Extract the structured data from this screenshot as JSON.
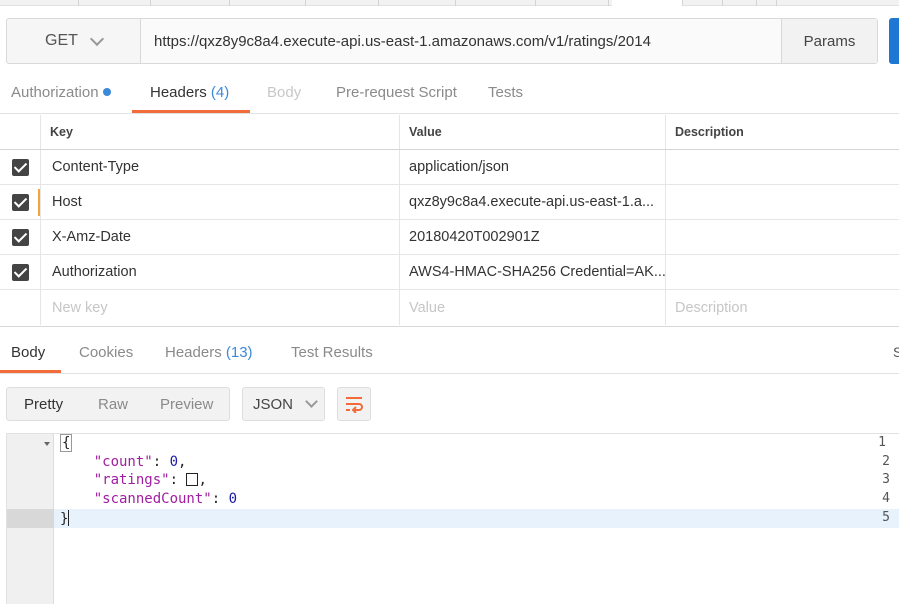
{
  "request": {
    "method": "GET",
    "url": "https://qxz8y9c8a4.execute-api.us-east-1.amazonaws.com/v1/ratings/2014",
    "params_label": "Params"
  },
  "request_tabs": {
    "authorization": "Authorization",
    "headers": "Headers",
    "headers_count": "(4)",
    "body": "Body",
    "prerequest": "Pre-request Script",
    "tests": "Tests"
  },
  "headers_table": {
    "columns": {
      "key": "Key",
      "value": "Value",
      "description": "Description"
    },
    "rows": [
      {
        "key": "Content-Type",
        "value": "application/json",
        "description": ""
      },
      {
        "key": "Host",
        "value": "qxz8y9c8a4.execute-api.us-east-1.a...",
        "description": ""
      },
      {
        "key": "X-Amz-Date",
        "value": "20180420T002901Z",
        "description": ""
      },
      {
        "key": "Authorization",
        "value": "AWS4-HMAC-SHA256 Credential=AK...",
        "description": ""
      }
    ],
    "placeholders": {
      "key": "New key",
      "value": "Value",
      "description": "Description"
    }
  },
  "response_tabs": {
    "body": "Body",
    "cookies": "Cookies",
    "headers": "Headers",
    "headers_count": "(13)",
    "test_results": "Test Results",
    "cut_label": "S"
  },
  "response_toolbar": {
    "pretty": "Pretty",
    "raw": "Raw",
    "preview": "Preview",
    "format": "JSON",
    "wrap_icon": "wrap-lines-icon"
  },
  "code": {
    "line_numbers": [
      "1",
      "2",
      "3",
      "4",
      "5"
    ],
    "open_brace": "{",
    "close_brace": "}",
    "key_count": "\"count\"",
    "val_count": "0",
    "key_ratings": "\"ratings\"",
    "key_scanned": "\"scannedCount\"",
    "val_scanned": "0"
  },
  "colors": {
    "accent": "#f26b3a",
    "link_blue": "#3b8ad9",
    "send_blue": "#1e77d3",
    "json_key": "#a11da1",
    "json_number": "#1a1aa6"
  }
}
